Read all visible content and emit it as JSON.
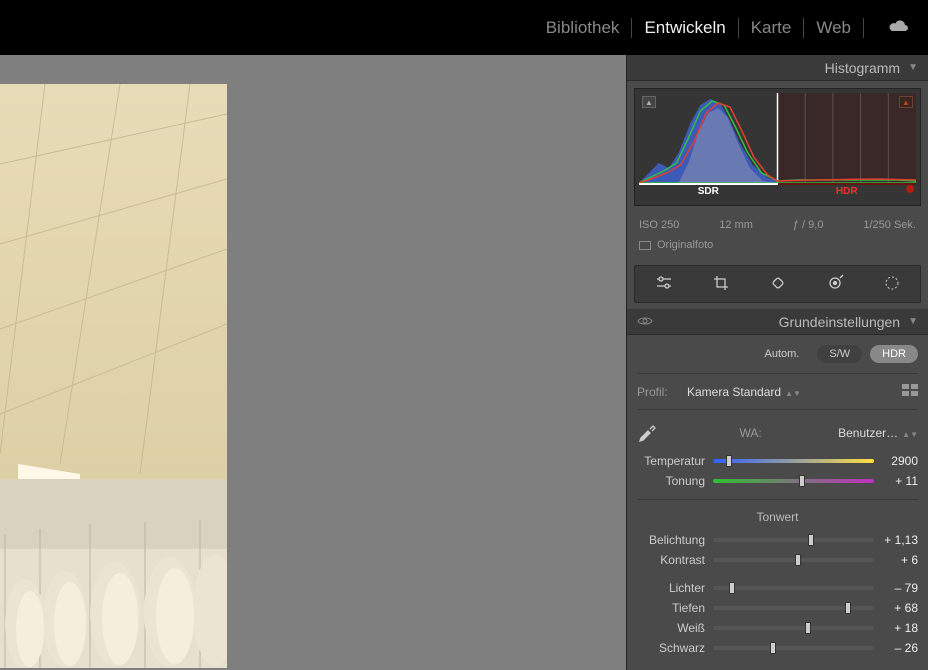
{
  "nav": {
    "items": [
      {
        "label": "Bibliothek",
        "active": false
      },
      {
        "label": "Entwickeln",
        "active": true
      },
      {
        "label": "Karte",
        "active": false
      },
      {
        "label": "Web",
        "active": false
      }
    ]
  },
  "histogram": {
    "title": "Histogramm",
    "sdr_label": "SDR",
    "hdr_label": "HDR",
    "meta": {
      "iso": "ISO 250",
      "focal": "12 mm",
      "aperture": "ƒ / 9,0",
      "shutter": "1/250 Sek."
    },
    "original_label": "Originalfoto"
  },
  "basic": {
    "title": "Grundeinstellungen",
    "auto_label": "Autom.",
    "bw_label": "S/W",
    "hdr_label": "HDR",
    "profile_label": "Profil:",
    "profile_value": "Kamera Standard",
    "wb_label": "WA:",
    "wb_value": "Benutzer…",
    "temp_label": "Temperatur",
    "temp_value": "2900",
    "tint_label": "Tonung",
    "tint_value": "+ 11",
    "tone_header": "Tonwert",
    "exposure_label": "Belichtung",
    "exposure_value": "+ 1,13",
    "contrast_label": "Kontrast",
    "contrast_value": "+ 6",
    "highlights_label": "Lichter",
    "highlights_value": "– 79",
    "shadows_label": "Tiefen",
    "shadows_value": "+ 68",
    "whites_label": "Weiß",
    "whites_value": "+ 18",
    "blacks_label": "Schwarz",
    "blacks_value": "– 26"
  },
  "slider_positions": {
    "temp": 10,
    "tint": 55,
    "exposure": 61,
    "contrast": 53,
    "highlights": 12,
    "shadows": 84,
    "whites": 59,
    "blacks": 37
  }
}
